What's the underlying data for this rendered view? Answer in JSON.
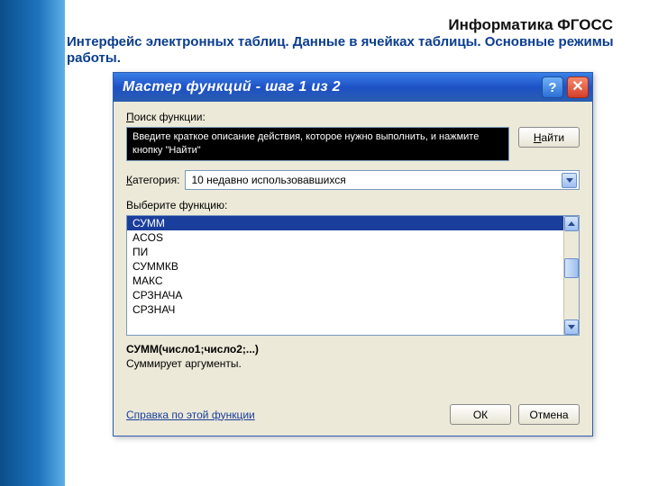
{
  "slide": {
    "header": "Информатика ФГОСС",
    "subtitle": "Интерфейс электронных таблиц. Данные в ячейках таблицы. Основные режимы работы."
  },
  "dialog": {
    "title": "Мастер функций - шаг 1 из 2",
    "search_label": "Поиск функции:",
    "search_text": "Введите краткое описание действия, которое нужно выполнить, и нажмите кнопку \"Найти\"",
    "find_btn": "Найти",
    "category_label": "Категория:",
    "category_value": "10 недавно использовавшихся",
    "select_label": "Выберите функцию:",
    "functions": [
      "СУММ",
      "ACOS",
      "ПИ",
      "СУММКВ",
      "МАКС",
      "СРЗНАЧА",
      "СРЗНАЧ"
    ],
    "selected_index": 0,
    "signature": "СУММ(число1;число2;...)",
    "description": "Суммирует аргументы.",
    "help_link": "Справка по этой функции",
    "ok_btn": "ОК",
    "cancel_btn": "Отмена"
  }
}
